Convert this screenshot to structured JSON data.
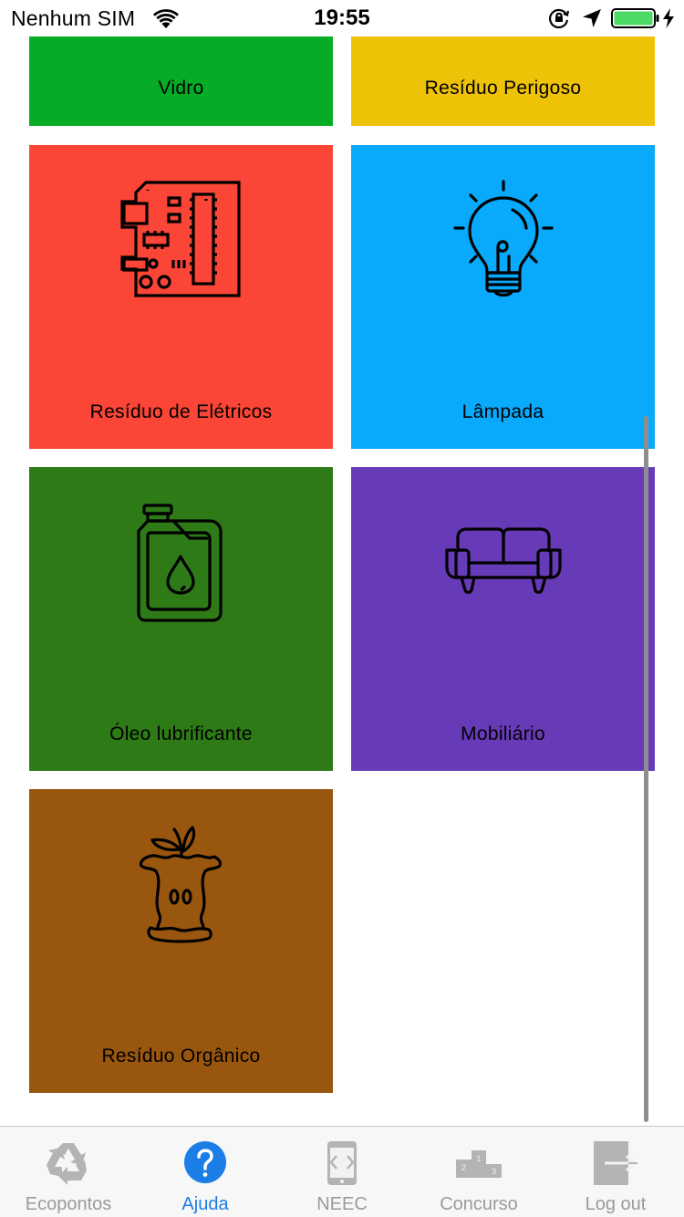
{
  "status_bar": {
    "carrier": "Nenhum SIM",
    "time": "19:55",
    "battery_color": "#4cd964"
  },
  "tiles": [
    {
      "label": "Vidro",
      "color": "#06ac26",
      "icon": "glass-icon"
    },
    {
      "label": "Resíduo Perigoso",
      "color": "#eec206",
      "icon": "hazard-icon"
    },
    {
      "label": "Resíduo de Elétricos",
      "color": "#fb4536",
      "icon": "circuit-board-icon"
    },
    {
      "label": "Lâmpada",
      "color": "#09a9fb",
      "icon": "light-bulb-icon"
    },
    {
      "label": "Óleo lubrificante",
      "color": "#2e7a17",
      "icon": "oil-canister-icon"
    },
    {
      "label": "Mobiliário",
      "color": "#673bb8",
      "icon": "sofa-icon"
    },
    {
      "label": "Resíduo Orgânico",
      "color": "#99560f",
      "icon": "apple-core-icon"
    }
  ],
  "tab_bar": {
    "active_color": "#1a7ee6",
    "inactive_color": "#9a9a9a",
    "tabs": [
      {
        "label": "Ecopontos",
        "icon": "recycle-icon",
        "active": false
      },
      {
        "label": "Ajuda",
        "icon": "help-icon",
        "active": true
      },
      {
        "label": "NEEC",
        "icon": "phone-icon",
        "active": false
      },
      {
        "label": "Concurso",
        "icon": "podium-icon",
        "active": false
      },
      {
        "label": "Log out",
        "icon": "logout-icon",
        "active": false
      }
    ]
  }
}
